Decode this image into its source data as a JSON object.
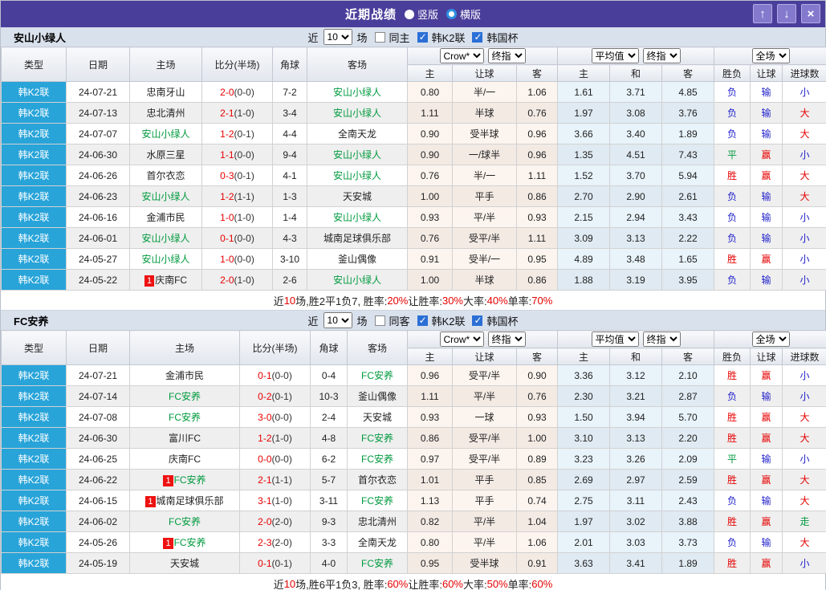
{
  "titlebar": {
    "title": "近期战绩",
    "vertical_label": "竖版",
    "horizontal_label": "横版",
    "up_button": "↑",
    "down_button": "↓",
    "close_button": "×",
    "bar_color": "#4a3e9b"
  },
  "table_header": {
    "col_type": "类型",
    "col_date": "日期",
    "col_home": "主场",
    "col_score": "比分(半场)",
    "col_corner": "角球",
    "col_away": "客场",
    "select_crow": "Crow*",
    "select_final": "终指",
    "select_avg": "平均值",
    "select_full": "全场",
    "sub_cols": [
      "主",
      "让球",
      "客",
      "主",
      "和",
      "客",
      "胜负",
      "让球",
      "进球数"
    ]
  },
  "colors": {
    "type_cell": "#28a4d9",
    "team_green": "#009a3e",
    "score_red": "#e60000",
    "win_red": "#e60000",
    "draw_green": "#009a3e",
    "lose_blue": "#2222cc"
  },
  "sections": [
    {
      "team": "安山小绿人",
      "filter": {
        "prefix": "近",
        "count": "10",
        "suffix": "场",
        "same_label": "同主",
        "league_label": "韩K2联",
        "cup_label": "韩国杯",
        "same_checked": false,
        "league_checked": true,
        "cup_checked": true
      },
      "rows": [
        {
          "type": "韩K2联",
          "date": "24-07-21",
          "home": "忠南牙山",
          "home_green": false,
          "home_badge": "",
          "score_ft": "2-0",
          "score_ht": "(0-0)",
          "corner": "7-2",
          "away": "安山小绿人",
          "away_green": true,
          "let_home": "0.80",
          "let_line": "半/一",
          "let_away": "1.06",
          "avg_home": "1.61",
          "avg_draw": "3.71",
          "avg_away": "4.85",
          "result": "负",
          "result_c": "blue",
          "let_res": "输",
          "let_res_c": "blue",
          "goal_res": "小",
          "goal_res_c": "blue"
        },
        {
          "type": "韩K2联",
          "date": "24-07-13",
          "home": "忠北清州",
          "home_green": false,
          "home_badge": "",
          "score_ft": "2-1",
          "score_ht": "(1-0)",
          "corner": "3-4",
          "away": "安山小绿人",
          "away_green": true,
          "let_home": "1.11",
          "let_line": "半球",
          "let_away": "0.76",
          "avg_home": "1.97",
          "avg_draw": "3.08",
          "avg_away": "3.76",
          "result": "负",
          "result_c": "blue",
          "let_res": "输",
          "let_res_c": "blue",
          "goal_res": "大",
          "goal_res_c": "red"
        },
        {
          "type": "韩K2联",
          "date": "24-07-07",
          "home": "安山小绿人",
          "home_green": true,
          "home_badge": "",
          "score_ft": "1-2",
          "score_ht": "(0-1)",
          "corner": "4-4",
          "away": "全南天龙",
          "away_green": false,
          "let_home": "0.90",
          "let_line": "受半球",
          "let_away": "0.96",
          "avg_home": "3.66",
          "avg_draw": "3.40",
          "avg_away": "1.89",
          "result": "负",
          "result_c": "blue",
          "let_res": "输",
          "let_res_c": "blue",
          "goal_res": "大",
          "goal_res_c": "red"
        },
        {
          "type": "韩K2联",
          "date": "24-06-30",
          "home": "水原三星",
          "home_green": false,
          "home_badge": "",
          "score_ft": "1-1",
          "score_ht": "(0-0)",
          "corner": "9-4",
          "away": "安山小绿人",
          "away_green": true,
          "let_home": "0.90",
          "let_line": "一/球半",
          "let_away": "0.96",
          "avg_home": "1.35",
          "avg_draw": "4.51",
          "avg_away": "7.43",
          "result": "平",
          "result_c": "green",
          "let_res": "赢",
          "let_res_c": "red",
          "goal_res": "小",
          "goal_res_c": "blue"
        },
        {
          "type": "韩K2联",
          "date": "24-06-26",
          "home": "首尔衣恋",
          "home_green": false,
          "home_badge": "",
          "score_ft": "0-3",
          "score_ht": "(0-1)",
          "corner": "4-1",
          "away": "安山小绿人",
          "away_green": true,
          "let_home": "0.76",
          "let_line": "半/一",
          "let_away": "1.11",
          "avg_home": "1.52",
          "avg_draw": "3.70",
          "avg_away": "5.94",
          "result": "胜",
          "result_c": "red",
          "let_res": "赢",
          "let_res_c": "red",
          "goal_res": "大",
          "goal_res_c": "red"
        },
        {
          "type": "韩K2联",
          "date": "24-06-23",
          "home": "安山小绿人",
          "home_green": true,
          "home_badge": "",
          "score_ft": "1-2",
          "score_ht": "(1-1)",
          "corner": "1-3",
          "away": "天安城",
          "away_green": false,
          "let_home": "1.00",
          "let_line": "平手",
          "let_away": "0.86",
          "avg_home": "2.70",
          "avg_draw": "2.90",
          "avg_away": "2.61",
          "result": "负",
          "result_c": "blue",
          "let_res": "输",
          "let_res_c": "blue",
          "goal_res": "大",
          "goal_res_c": "red"
        },
        {
          "type": "韩K2联",
          "date": "24-06-16",
          "home": "金浦市民",
          "home_green": false,
          "home_badge": "",
          "score_ft": "1-0",
          "score_ht": "(1-0)",
          "corner": "1-4",
          "away": "安山小绿人",
          "away_green": true,
          "let_home": "0.93",
          "let_line": "平/半",
          "let_away": "0.93",
          "avg_home": "2.15",
          "avg_draw": "2.94",
          "avg_away": "3.43",
          "result": "负",
          "result_c": "blue",
          "let_res": "输",
          "let_res_c": "blue",
          "goal_res": "小",
          "goal_res_c": "blue"
        },
        {
          "type": "韩K2联",
          "date": "24-06-01",
          "home": "安山小绿人",
          "home_green": true,
          "home_badge": "",
          "score_ft": "0-1",
          "score_ht": "(0-0)",
          "corner": "4-3",
          "away": "城南足球俱乐部",
          "away_green": false,
          "let_home": "0.76",
          "let_line": "受平/半",
          "let_away": "1.11",
          "avg_home": "3.09",
          "avg_draw": "3.13",
          "avg_away": "2.22",
          "result": "负",
          "result_c": "blue",
          "let_res": "输",
          "let_res_c": "blue",
          "goal_res": "小",
          "goal_res_c": "blue"
        },
        {
          "type": "韩K2联",
          "date": "24-05-27",
          "home": "安山小绿人",
          "home_green": true,
          "home_badge": "",
          "score_ft": "1-0",
          "score_ht": "(0-0)",
          "corner": "3-10",
          "away": "釜山偶像",
          "away_green": false,
          "let_home": "0.91",
          "let_line": "受半/一",
          "let_away": "0.95",
          "avg_home": "4.89",
          "avg_draw": "3.48",
          "avg_away": "1.65",
          "result": "胜",
          "result_c": "red",
          "let_res": "赢",
          "let_res_c": "red",
          "goal_res": "小",
          "goal_res_c": "blue"
        },
        {
          "type": "韩K2联",
          "date": "24-05-22",
          "home": "庆南FC",
          "home_green": false,
          "home_badge": "1",
          "score_ft": "2-0",
          "score_ht": "(1-0)",
          "corner": "2-6",
          "away": "安山小绿人",
          "away_green": true,
          "let_home": "1.00",
          "let_line": "半球",
          "let_away": "0.86",
          "avg_home": "1.88",
          "avg_draw": "3.19",
          "avg_away": "3.95",
          "result": "负",
          "result_c": "blue",
          "let_res": "输",
          "let_res_c": "blue",
          "goal_res": "小",
          "goal_res_c": "blue"
        }
      ],
      "footer": {
        "parts": [
          {
            "t": "近",
            "red": false
          },
          {
            "t": "10",
            "red": true
          },
          {
            "t": "场,胜2平1负7, 胜率:",
            "red": false
          },
          {
            "t": "20%",
            "red": true
          },
          {
            "t": " 让胜率:",
            "red": false
          },
          {
            "t": "30%",
            "red": true
          },
          {
            "t": " 大率:",
            "red": false
          },
          {
            "t": "40%",
            "red": true
          },
          {
            "t": " 单率:",
            "red": false
          },
          {
            "t": "70%",
            "red": true
          }
        ]
      }
    },
    {
      "team": "FC安养",
      "filter": {
        "prefix": "近",
        "count": "10",
        "suffix": "场",
        "same_label": "同客",
        "league_label": "韩K2联",
        "cup_label": "韩国杯",
        "same_checked": false,
        "league_checked": true,
        "cup_checked": true
      },
      "rows": [
        {
          "type": "韩K2联",
          "date": "24-07-21",
          "home": "金浦市民",
          "home_green": false,
          "home_badge": "",
          "score_ft": "0-1",
          "score_ht": "(0-0)",
          "corner": "0-4",
          "away": "FC安养",
          "away_green": true,
          "let_home": "0.96",
          "let_line": "受平/半",
          "let_away": "0.90",
          "avg_home": "3.36",
          "avg_draw": "3.12",
          "avg_away": "2.10",
          "result": "胜",
          "result_c": "red",
          "let_res": "赢",
          "let_res_c": "red",
          "goal_res": "小",
          "goal_res_c": "blue"
        },
        {
          "type": "韩K2联",
          "date": "24-07-14",
          "home": "FC安养",
          "home_green": true,
          "home_badge": "",
          "score_ft": "0-2",
          "score_ht": "(0-1)",
          "corner": "10-3",
          "away": "釜山偶像",
          "away_green": false,
          "let_home": "1.11",
          "let_line": "平/半",
          "let_away": "0.76",
          "avg_home": "2.30",
          "avg_draw": "3.21",
          "avg_away": "2.87",
          "result": "负",
          "result_c": "blue",
          "let_res": "输",
          "let_res_c": "blue",
          "goal_res": "小",
          "goal_res_c": "blue"
        },
        {
          "type": "韩K2联",
          "date": "24-07-08",
          "home": "FC安养",
          "home_green": true,
          "home_badge": "",
          "score_ft": "3-0",
          "score_ht": "(0-0)",
          "corner": "2-4",
          "away": "天安城",
          "away_green": false,
          "let_home": "0.93",
          "let_line": "一球",
          "let_away": "0.93",
          "avg_home": "1.50",
          "avg_draw": "3.94",
          "avg_away": "5.70",
          "result": "胜",
          "result_c": "red",
          "let_res": "赢",
          "let_res_c": "red",
          "goal_res": "大",
          "goal_res_c": "red"
        },
        {
          "type": "韩K2联",
          "date": "24-06-30",
          "home": "富川FC",
          "home_green": false,
          "home_badge": "",
          "score_ft": "1-2",
          "score_ht": "(1-0)",
          "corner": "4-8",
          "away": "FC安养",
          "away_green": true,
          "let_home": "0.86",
          "let_line": "受平/半",
          "let_away": "1.00",
          "avg_home": "3.10",
          "avg_draw": "3.13",
          "avg_away": "2.20",
          "result": "胜",
          "result_c": "red",
          "let_res": "赢",
          "let_res_c": "red",
          "goal_res": "大",
          "goal_res_c": "red"
        },
        {
          "type": "韩K2联",
          "date": "24-06-25",
          "home": "庆南FC",
          "home_green": false,
          "home_badge": "",
          "score_ft": "0-0",
          "score_ht": "(0-0)",
          "corner": "6-2",
          "away": "FC安养",
          "away_green": true,
          "let_home": "0.97",
          "let_line": "受平/半",
          "let_away": "0.89",
          "avg_home": "3.23",
          "avg_draw": "3.26",
          "avg_away": "2.09",
          "result": "平",
          "result_c": "green",
          "let_res": "输",
          "let_res_c": "blue",
          "goal_res": "小",
          "goal_res_c": "blue"
        },
        {
          "type": "韩K2联",
          "date": "24-06-22",
          "home": "FC安养",
          "home_green": true,
          "home_badge": "1",
          "score_ft": "2-1",
          "score_ht": "(1-1)",
          "corner": "5-7",
          "away": "首尔衣恋",
          "away_green": false,
          "let_home": "1.01",
          "let_line": "平手",
          "let_away": "0.85",
          "avg_home": "2.69",
          "avg_draw": "2.97",
          "avg_away": "2.59",
          "result": "胜",
          "result_c": "red",
          "let_res": "赢",
          "let_res_c": "red",
          "goal_res": "大",
          "goal_res_c": "red"
        },
        {
          "type": "韩K2联",
          "date": "24-06-15",
          "home": "城南足球俱乐部",
          "home_green": false,
          "home_badge": "1",
          "score_ft": "3-1",
          "score_ht": "(1-0)",
          "corner": "3-11",
          "away": "FC安养",
          "away_green": true,
          "let_home": "1.13",
          "let_line": "平手",
          "let_away": "0.74",
          "avg_home": "2.75",
          "avg_draw": "3.11",
          "avg_away": "2.43",
          "result": "负",
          "result_c": "blue",
          "let_res": "输",
          "let_res_c": "blue",
          "goal_res": "大",
          "goal_res_c": "red"
        },
        {
          "type": "韩K2联",
          "date": "24-06-02",
          "home": "FC安养",
          "home_green": true,
          "home_badge": "",
          "score_ft": "2-0",
          "score_ht": "(2-0)",
          "corner": "9-3",
          "away": "忠北清州",
          "away_green": false,
          "let_home": "0.82",
          "let_line": "平/半",
          "let_away": "1.04",
          "avg_home": "1.97",
          "avg_draw": "3.02",
          "avg_away": "3.88",
          "result": "胜",
          "result_c": "red",
          "let_res": "赢",
          "let_res_c": "red",
          "goal_res": "走",
          "goal_res_c": "green"
        },
        {
          "type": "韩K2联",
          "date": "24-05-26",
          "home": "FC安养",
          "home_green": true,
          "home_badge": "1",
          "score_ft": "2-3",
          "score_ht": "(2-0)",
          "corner": "3-3",
          "away": "全南天龙",
          "away_green": false,
          "let_home": "0.80",
          "let_line": "平/半",
          "let_away": "1.06",
          "avg_home": "2.01",
          "avg_draw": "3.03",
          "avg_away": "3.73",
          "result": "负",
          "result_c": "blue",
          "let_res": "输",
          "let_res_c": "blue",
          "goal_res": "大",
          "goal_res_c": "red"
        },
        {
          "type": "韩K2联",
          "date": "24-05-19",
          "home": "天安城",
          "home_green": false,
          "home_badge": "",
          "score_ft": "0-1",
          "score_ht": "(0-1)",
          "corner": "4-0",
          "away": "FC安养",
          "away_green": true,
          "let_home": "0.95",
          "let_line": "受半球",
          "let_away": "0.91",
          "avg_home": "3.63",
          "avg_draw": "3.41",
          "avg_away": "1.89",
          "result": "胜",
          "result_c": "red",
          "let_res": "赢",
          "let_res_c": "red",
          "goal_res": "小",
          "goal_res_c": "blue"
        }
      ],
      "footer": {
        "parts": [
          {
            "t": "近",
            "red": false
          },
          {
            "t": "10",
            "red": true
          },
          {
            "t": "场,胜6平1负3, 胜率:",
            "red": false
          },
          {
            "t": "60%",
            "red": true
          },
          {
            "t": " 让胜率:",
            "red": false
          },
          {
            "t": "60%",
            "red": true
          },
          {
            "t": " 大率:",
            "red": false
          },
          {
            "t": "50%",
            "red": true
          },
          {
            "t": " 单率:",
            "red": false
          },
          {
            "t": "60%",
            "red": true
          }
        ]
      }
    }
  ]
}
